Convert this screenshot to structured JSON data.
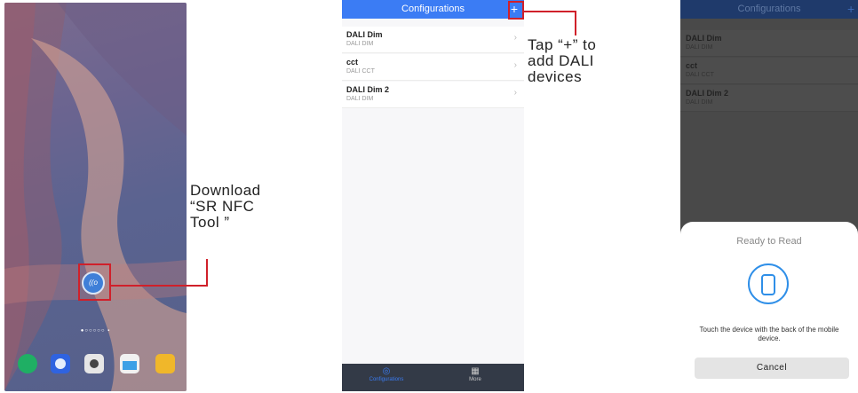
{
  "home_screen": {
    "page_dots": "●○○○○○ ▪",
    "app_icon_label": "((o"
  },
  "annotations": {
    "download_note": [
      "Download",
      "“SR NFC",
      "Tool ”"
    ],
    "tap_plus_note": [
      "Tap “+” to",
      "add DALI",
      "devices"
    ]
  },
  "configurations_screen": {
    "title": "Configurations",
    "add_button": "+",
    "items": [
      {
        "name": "DALI Dim",
        "type": "DALI DIM"
      },
      {
        "name": "cct",
        "type": "DALI CCT"
      },
      {
        "name": "DALI Dim 2",
        "type": "DALI DIM"
      }
    ],
    "chevron": "›",
    "tabs": [
      {
        "label": "Configurations",
        "icon": "nfc-tab-icon",
        "glyph": "◎",
        "active": true
      },
      {
        "label": "More",
        "icon": "grid-icon",
        "glyph": "▦",
        "active": false
      }
    ],
    "accent_color": "#3b7cf4"
  },
  "scan_screen": {
    "title": "Configurations",
    "add_button": "+",
    "items": [
      {
        "name": "DALI Dim",
        "type": "DALI DIM"
      },
      {
        "name": "cct",
        "type": "DALI CCT"
      },
      {
        "name": "DALI Dim 2",
        "type": "DALI DIM"
      }
    ],
    "sheet": {
      "title": "Ready to Read",
      "message": "Touch the device with the back of the mobile device.",
      "cancel_label": "Cancel"
    }
  }
}
